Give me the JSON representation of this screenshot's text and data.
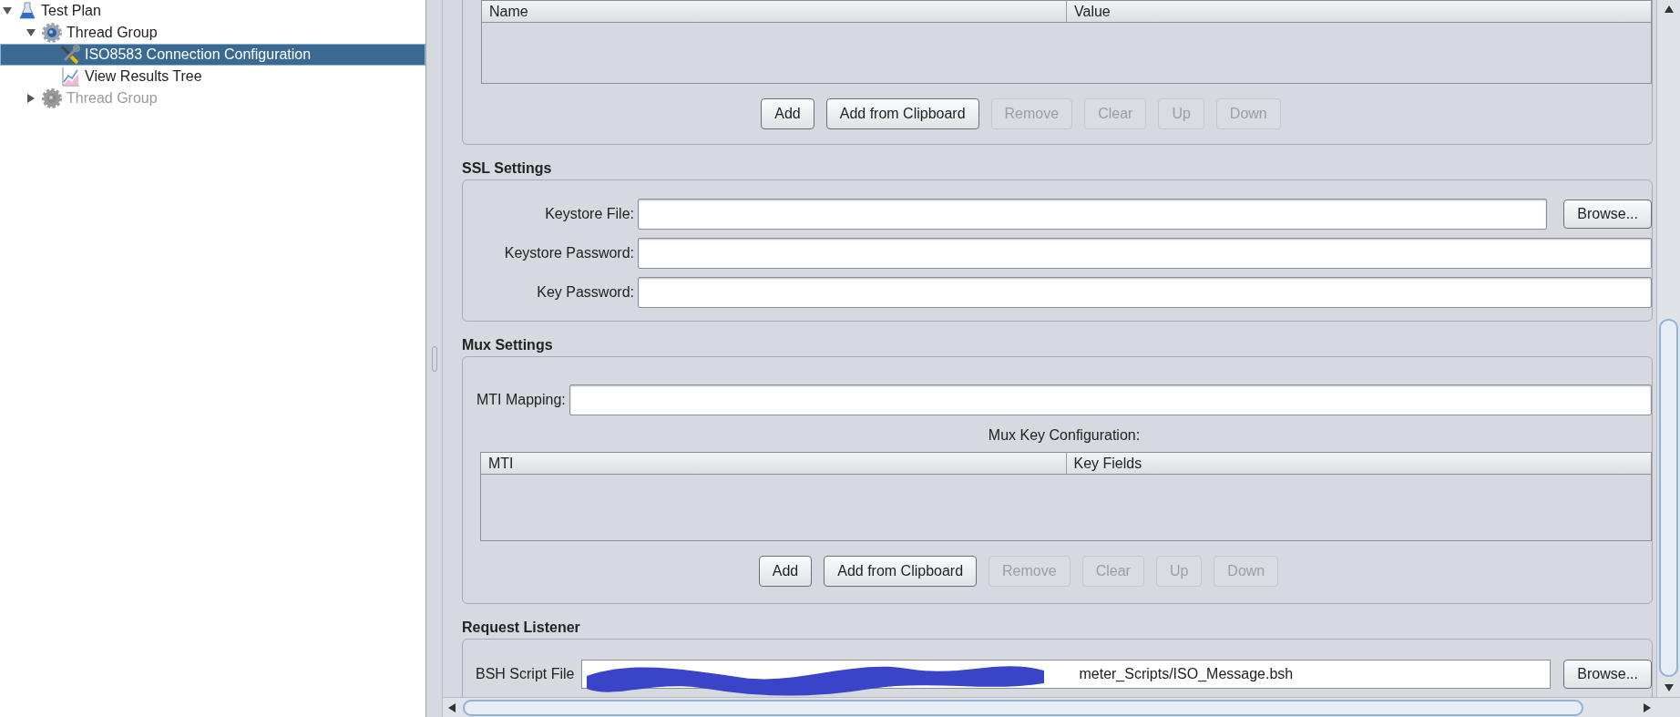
{
  "tree": [
    {
      "label": "Test Plan",
      "kind": "flask",
      "expanded": true,
      "selected": false,
      "disabled": false,
      "children": [
        {
          "label": "Thread Group",
          "kind": "gear",
          "expanded": true,
          "selected": false,
          "disabled": false,
          "children": [
            {
              "label": "ISO8583 Connection Configuration",
              "kind": "tools",
              "selected": true,
              "disabled": false
            },
            {
              "label": "View Results Tree",
              "kind": "graph",
              "selected": false,
              "disabled": false
            }
          ]
        },
        {
          "label": "Thread Group",
          "kind": "gear",
          "expanded": false,
          "selected": false,
          "disabled": true
        }
      ]
    }
  ],
  "top_table": {
    "columns": [
      "Name",
      "Value"
    ],
    "buttons": [
      {
        "label": "Add",
        "disabled": false
      },
      {
        "label": "Add from Clipboard",
        "disabled": false
      },
      {
        "label": "Remove",
        "disabled": true
      },
      {
        "label": "Clear",
        "disabled": true
      },
      {
        "label": "Up",
        "disabled": true
      },
      {
        "label": "Down",
        "disabled": true
      }
    ]
  },
  "ssl_settings": {
    "title": "SSL Settings",
    "fields": [
      {
        "label": "Keystore File:",
        "browse": "Browse..."
      },
      {
        "label": "Keystore Password:"
      },
      {
        "label": "Key Password:"
      }
    ]
  },
  "mux_settings": {
    "title": "Mux Settings",
    "mti_mapping_label": "MTI Mapping:",
    "table_title": "Mux Key Configuration:",
    "columns": [
      "MTI",
      "Key Fields"
    ],
    "buttons": [
      {
        "label": "Add",
        "disabled": false
      },
      {
        "label": "Add from Clipboard",
        "disabled": false
      },
      {
        "label": "Remove",
        "disabled": true
      },
      {
        "label": "Clear",
        "disabled": true
      },
      {
        "label": "Up",
        "disabled": true
      },
      {
        "label": "Down",
        "disabled": true
      }
    ]
  },
  "request_listener": {
    "title": "Request Listener",
    "label": "BSH Script File",
    "value": "meter_Scripts/ISO_Message.bsh",
    "browse": "Browse..."
  }
}
